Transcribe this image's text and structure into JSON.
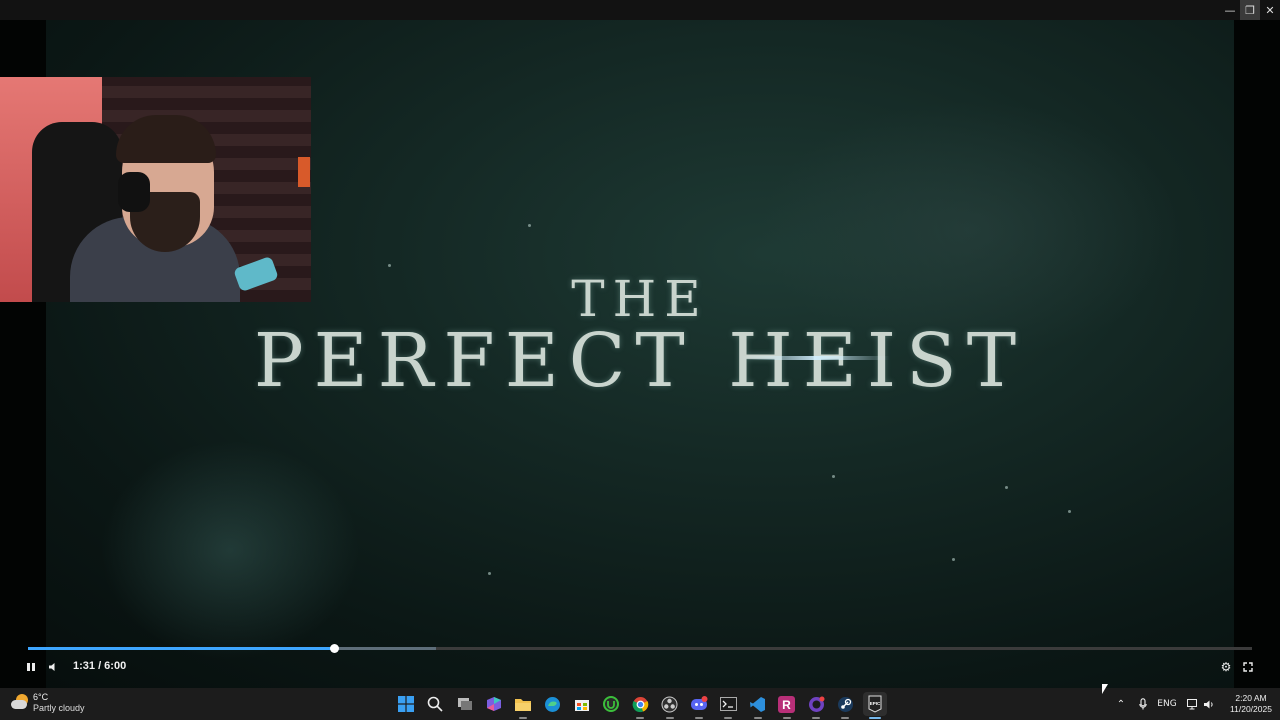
{
  "window": {
    "controls": [
      "minimize",
      "restore",
      "close"
    ]
  },
  "video": {
    "title_line1": "THE",
    "title_line2": "PERFECT HEIST"
  },
  "player": {
    "time_display": "1:31 / 6:00",
    "played_fraction": 0.25,
    "buffered_fraction": 0.333,
    "accent_color": "#3ea6ff",
    "icons": {
      "play_pause": "pause-icon",
      "volume": "volume-icon",
      "settings": "gear-icon",
      "fullscreen": "fullscreen-icon"
    }
  },
  "taskbar": {
    "weather": {
      "temperature": "6°C",
      "condition": "Partly cloudy"
    },
    "apps": [
      {
        "name": "windows-start-icon",
        "label": ""
      },
      {
        "name": "search-icon",
        "label": ""
      },
      {
        "name": "task-view-icon",
        "label": ""
      },
      {
        "name": "microsoft-365-icon",
        "label": "M365"
      },
      {
        "name": "file-explorer-icon",
        "label": ""
      },
      {
        "name": "edge-icon",
        "label": ""
      },
      {
        "name": "microsoft-store-icon",
        "label": ""
      },
      {
        "name": "utorrent-icon",
        "label": ""
      },
      {
        "name": "chrome-icon",
        "label": ""
      },
      {
        "name": "obs-icon",
        "label": ""
      },
      {
        "name": "discord-icon",
        "label": "99+"
      },
      {
        "name": "terminal-icon",
        "label": ""
      },
      {
        "name": "vscode-icon",
        "label": ""
      },
      {
        "name": "rider-icon",
        "label": "R"
      },
      {
        "name": "github-desktop-icon",
        "label": ""
      },
      {
        "name": "steam-icon",
        "label": ""
      },
      {
        "name": "epic-games-icon",
        "label": "EPIC"
      }
    ],
    "tray": {
      "language": "ENG",
      "time": "2:20 AM",
      "date": "11/20/2025"
    }
  }
}
